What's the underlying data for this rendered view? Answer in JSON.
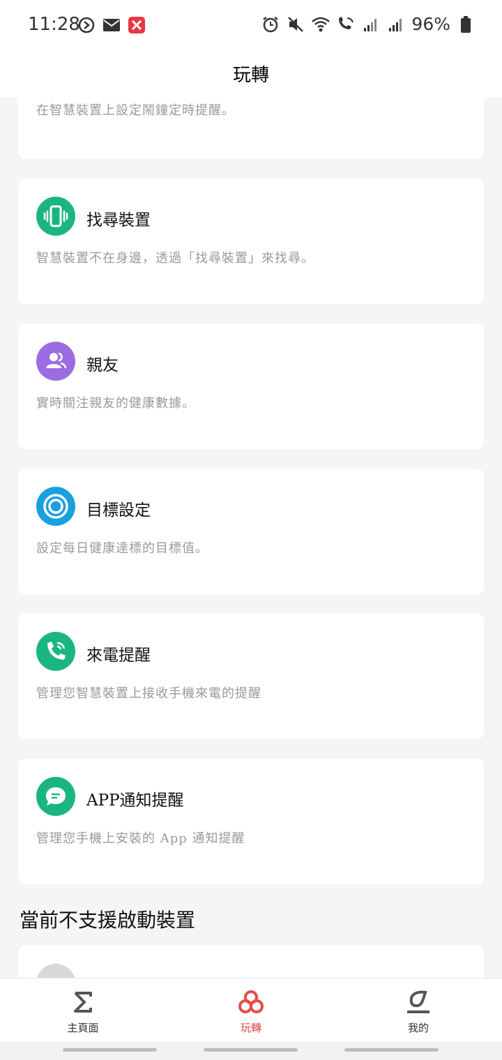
{
  "status_bar": {
    "time": "11:28",
    "battery_percent": "96%",
    "left_icons": [
      "nav-arrow-icon",
      "mail-icon",
      "app-notification-icon"
    ],
    "right_icons": [
      "alarm-icon",
      "mute-icon",
      "wifi-icon",
      "wifi-calling-icon",
      "signal-icon",
      "signal-icon"
    ]
  },
  "header": {
    "title": "玩轉"
  },
  "partial_card": {
    "desc": "在智慧裝置上設定鬧鐘定時提醒。"
  },
  "cards": [
    {
      "title": "找尋裝置",
      "desc": "智慧裝置不在身邊，透過「找尋裝置」來找尋。",
      "icon": "vibrate-phone-icon",
      "color": "#1bb584"
    },
    {
      "title": "親友",
      "desc": "實時關注親友的健康數據。",
      "icon": "contacts-icon",
      "color": "#9b6de0"
    },
    {
      "title": "目標設定",
      "desc": "設定每日健康達標的目標值。",
      "icon": "target-icon",
      "color": "#1a9fe0"
    },
    {
      "title": "來電提醒",
      "desc": "管理您智慧裝置上接收手機來電的提醒",
      "icon": "phone-call-icon",
      "color": "#1bb584"
    },
    {
      "title": "APP通知提醒",
      "desc": "管理您手機上安裝的 App 通知提醒",
      "icon": "message-icon",
      "color": "#1bb584"
    }
  ],
  "section": {
    "title": "當前不支援啟動裝置"
  },
  "bottom_nav": {
    "items": [
      {
        "label": "主頁面",
        "icon": "sigma-icon",
        "active": false
      },
      {
        "label": "玩轉",
        "icon": "rings-icon",
        "active": true
      },
      {
        "label": "我的",
        "icon": "profile-icon",
        "active": false
      }
    ]
  },
  "colors": {
    "accent": "#e84a4a",
    "background": "#f5f5f5"
  }
}
